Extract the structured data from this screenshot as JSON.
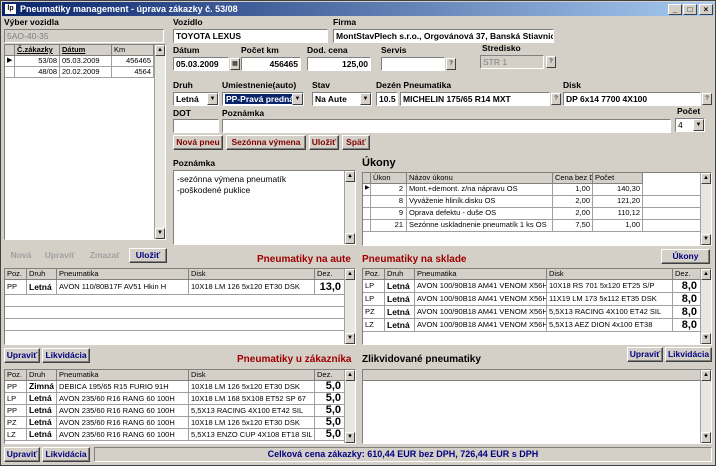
{
  "window": {
    "title": "Pneumatiky management - úprava zákazky č. 53/08",
    "icon_text": "lp"
  },
  "left": {
    "vyber_label": "Výber vozidla",
    "plate": "5AO-40-35",
    "cols": [
      "Č.zákazky",
      "Dátum",
      "Km"
    ],
    "rows": [
      [
        "53/08",
        "05.03.2009",
        "456465"
      ],
      [
        "48/08",
        "20.02.2009",
        "4564"
      ]
    ],
    "buttons": {
      "nova": "Nová",
      "upravit": "Upraviť",
      "zmazat": "Zmazať",
      "ulozit": "Uložiť"
    }
  },
  "vehicle": {
    "vozidlo_label": "Vozidlo",
    "vozidlo": "TOYOTA LEXUS",
    "firma_label": "Firma",
    "firma": "MontStavPlech s.r.o., Orgovánová 37, Banská Stiavnica",
    "datum_label": "Dátum",
    "datum": "05.03.2009",
    "pocet_km_label": "Počet km",
    "pocet_km": "456465",
    "dod_cena_label": "Dod. cena",
    "dod_cena": "125,00",
    "servis_label": "Servis",
    "servis": "",
    "stredisko_label": "Stredisko",
    "stredisko": "STR 1"
  },
  "tire": {
    "druh_label": "Druh",
    "druh": "Letná",
    "umiestnenie_label": "Umiestnenie(auto)",
    "umiestnenie": "PP-Pravá predná",
    "stav_label": "Stav",
    "stav": "Na Aute",
    "dezen_label": "Dezén Pneumatika",
    "dezen": "10.5",
    "dezen_name": "MICHELIN 175/65 R14 MXT",
    "disk_label": "Disk",
    "disk": "DP  6x14 7700 4X100",
    "dot_label": "DOT",
    "dot": "",
    "poznamka_label": "Poznámka",
    "poznamka": "",
    "pocet_label": "Počet",
    "pocet": "4"
  },
  "action_buttons": {
    "nova_pneu": "Nová pneu",
    "sezonna": "Sezónna výmena",
    "ulozit": "Uložiť",
    "spat": "Späť"
  },
  "note": {
    "label": "Poznámka",
    "lines": [
      "-sezónna výmena pneumatík",
      "-poškodené puklice"
    ]
  },
  "ukony": {
    "label": "Úkony",
    "cols": [
      "Úkon",
      "Názov úkonu",
      "Cena bez DPH",
      "Počet"
    ],
    "rows": [
      [
        "2",
        "Mont.+demont. z/na nápravu OS",
        "1,00",
        "140,30"
      ],
      [
        "8",
        "Vyváženie hliník.disku OS",
        "2,00",
        "121,20"
      ],
      [
        "9",
        "Oprava defektu - duše OS",
        "2,00",
        "110,12"
      ],
      [
        "21",
        "Sezónne uskladnenie pneumatík 1 ks OS",
        "7,50",
        "1,00"
      ]
    ],
    "button": "Úkony"
  },
  "na_aute": {
    "title": "Pneumatiky na aute",
    "cols": [
      "Poz.",
      "Druh",
      "Pneumatika",
      "Disk",
      "Dez."
    ],
    "rows": [
      [
        "PP",
        "Letná",
        "AVON 110/80B17F AV51 Hkin H",
        "10X18 LM 126  5x120  ET30 DSK",
        "13,0"
      ]
    ]
  },
  "na_sklade": {
    "title": "Pneumatiky na sklade",
    "cols": [
      "Poz.",
      "Druh",
      "Pneumatika",
      "Disk",
      "Dez."
    ],
    "rows": [
      [
        "LP",
        "Letná",
        "AVON 100/90B18 AM41 VENOM X56H",
        "10X18  RS 701  5x120  ET25 S/P",
        "8,0"
      ],
      [
        "LP",
        "Letná",
        "AVON 100/90B18 AM41 VENOM X56H",
        "11X19 LM 173  5x112  ET35 DSK",
        "8,0"
      ],
      [
        "PZ",
        "Letná",
        "AVON 100/90B18 AM41 VENOM X56H",
        "5,5X13 RACING 4X100  ET42 SIL",
        "8,0"
      ],
      [
        "LZ",
        "Letná",
        "AVON 100/90B18 AM41 VENOM X56H",
        "5,5X13 AEZ DION  4x100  ET38",
        "8,0"
      ]
    ]
  },
  "u_zakaznika": {
    "title": "Pneumatiky u zákazníka",
    "cols": [
      "Poz.",
      "Druh",
      "Pneumatika",
      "Disk",
      "Dez."
    ],
    "rows": [
      [
        "PP",
        "Zimná",
        "DEBICA 195/65 R15 FURIO   91H",
        "10X18 LM 126  5x120  ET30 DSK",
        "5,0"
      ],
      [
        "LP",
        "Letná",
        "AVON  235/60 R16 RANG 60 100H",
        "10X18 LM 168 5X108 ET52 SP 67",
        "5,0"
      ],
      [
        "PP",
        "Letná",
        "AVON  235/60 R16 RANG 60 100H",
        "5,5X13 RACING 4X100   ET42 SIL",
        "5,0"
      ],
      [
        "PZ",
        "Letná",
        "AVON  235/60 R16 RANG 60 100H",
        "10X18 LM 126  5x120  ET30 DSK",
        "5,0"
      ],
      [
        "LZ",
        "Letná",
        "AVON  235/60 R16 RANG 60 100H",
        "5,5X13 ENZO CUP 4X108 ET18 SIL",
        "5,0"
      ]
    ]
  },
  "zlikvidovane": {
    "title": "Zlikvidované pneumatiky"
  },
  "upravit": "Upraviť",
  "likvidacia": "Likvidácia",
  "status": "Celková cena zákazky: 610,44 EUR bez DPH, 726,44 EUR s DPH"
}
